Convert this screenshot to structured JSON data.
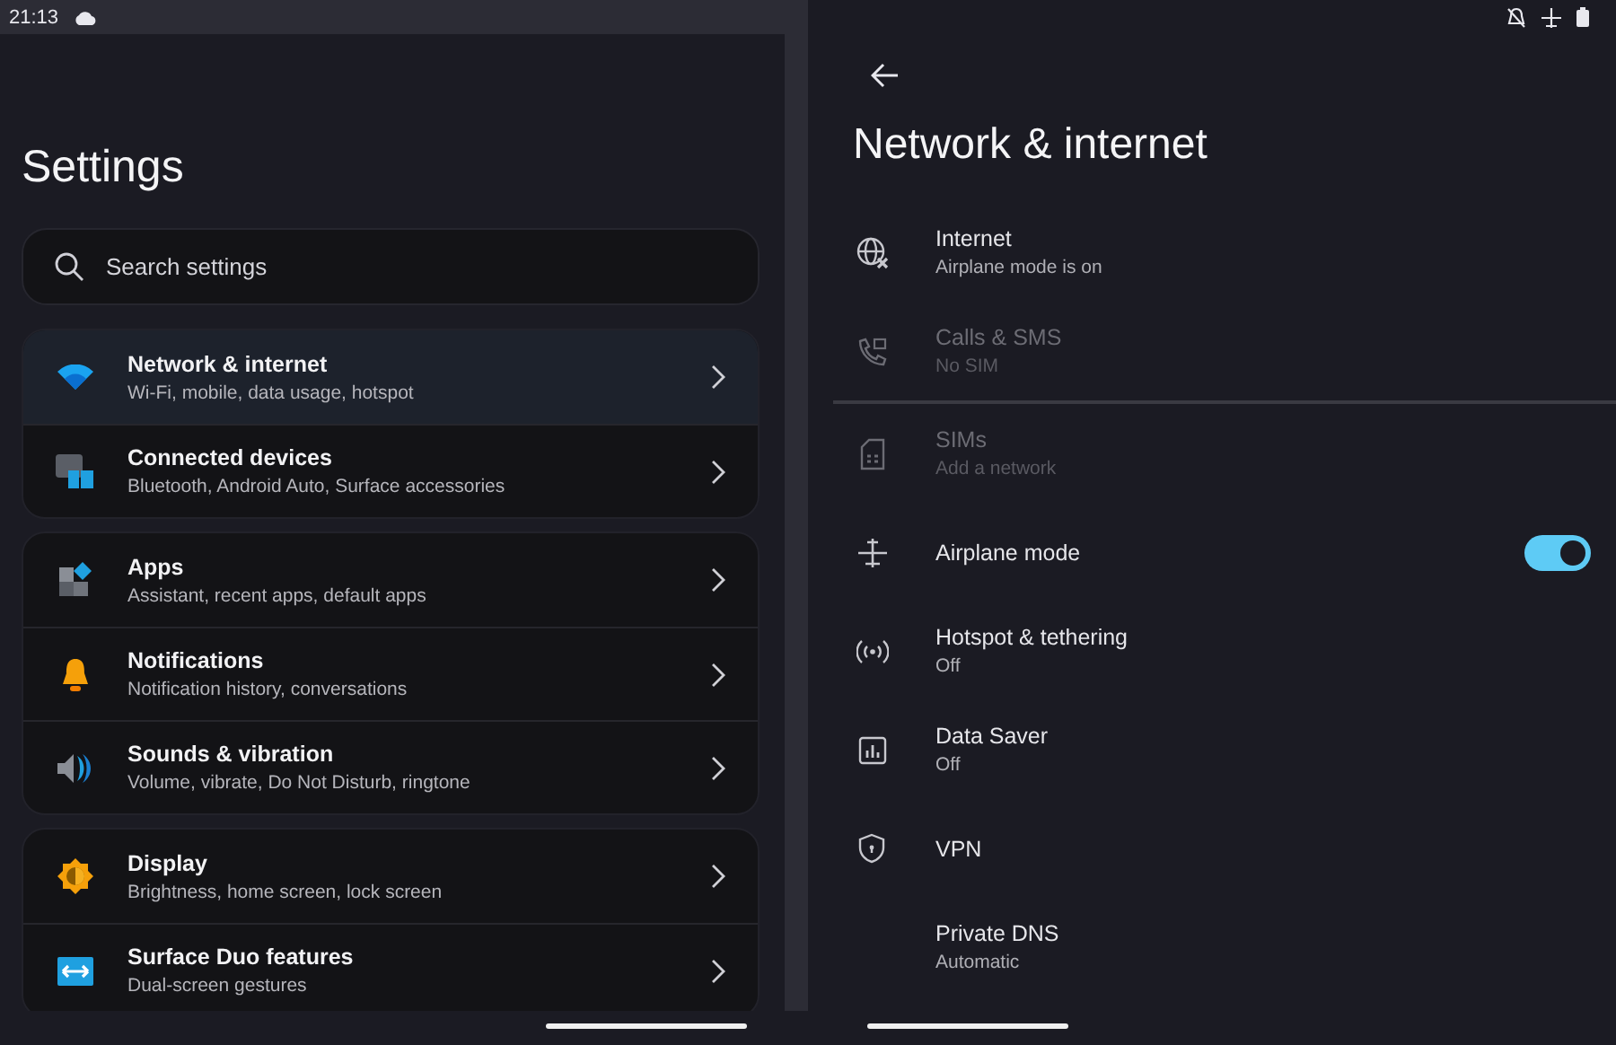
{
  "status_bar": {
    "time": "21:13"
  },
  "settings": {
    "title": "Settings",
    "search": {
      "placeholder": "Search settings"
    },
    "groups": [
      [
        {
          "title": "Network & internet",
          "subtitle": "Wi-Fi, mobile, data usage, hotspot",
          "selected": true
        },
        {
          "title": "Connected devices",
          "subtitle": "Bluetooth, Android Auto, Surface accessories",
          "selected": false
        }
      ],
      [
        {
          "title": "Apps",
          "subtitle": "Assistant, recent apps, default apps",
          "selected": false
        },
        {
          "title": "Notifications",
          "subtitle": "Notification history, conversations",
          "selected": false
        },
        {
          "title": "Sounds & vibration",
          "subtitle": "Volume, vibrate, Do Not Disturb, ringtone",
          "selected": false
        }
      ],
      [
        {
          "title": "Display",
          "subtitle": "Brightness, home screen, lock screen",
          "selected": false
        },
        {
          "title": "Surface Duo features",
          "subtitle": "Dual-screen gestures",
          "selected": false
        }
      ]
    ]
  },
  "network": {
    "title": "Network & internet",
    "items": [
      {
        "kind": "link",
        "title": "Internet",
        "subtitle": "Airplane mode is on",
        "disabled": false
      },
      {
        "kind": "link",
        "title": "Calls & SMS",
        "subtitle": "No SIM",
        "disabled": true
      },
      {
        "kind": "divider"
      },
      {
        "kind": "link",
        "title": "SIMs",
        "subtitle": "Add a network",
        "disabled": true
      },
      {
        "kind": "toggle",
        "title": "Airplane mode",
        "on": true,
        "disabled": false
      },
      {
        "kind": "link",
        "title": "Hotspot & tethering",
        "subtitle": "Off",
        "disabled": false
      },
      {
        "kind": "link",
        "title": "Data Saver",
        "subtitle": "Off",
        "disabled": false
      },
      {
        "kind": "link",
        "title": "VPN",
        "disabled": false
      },
      {
        "kind": "link",
        "title": "Private DNS",
        "subtitle": "Automatic",
        "disabled": false
      }
    ]
  }
}
